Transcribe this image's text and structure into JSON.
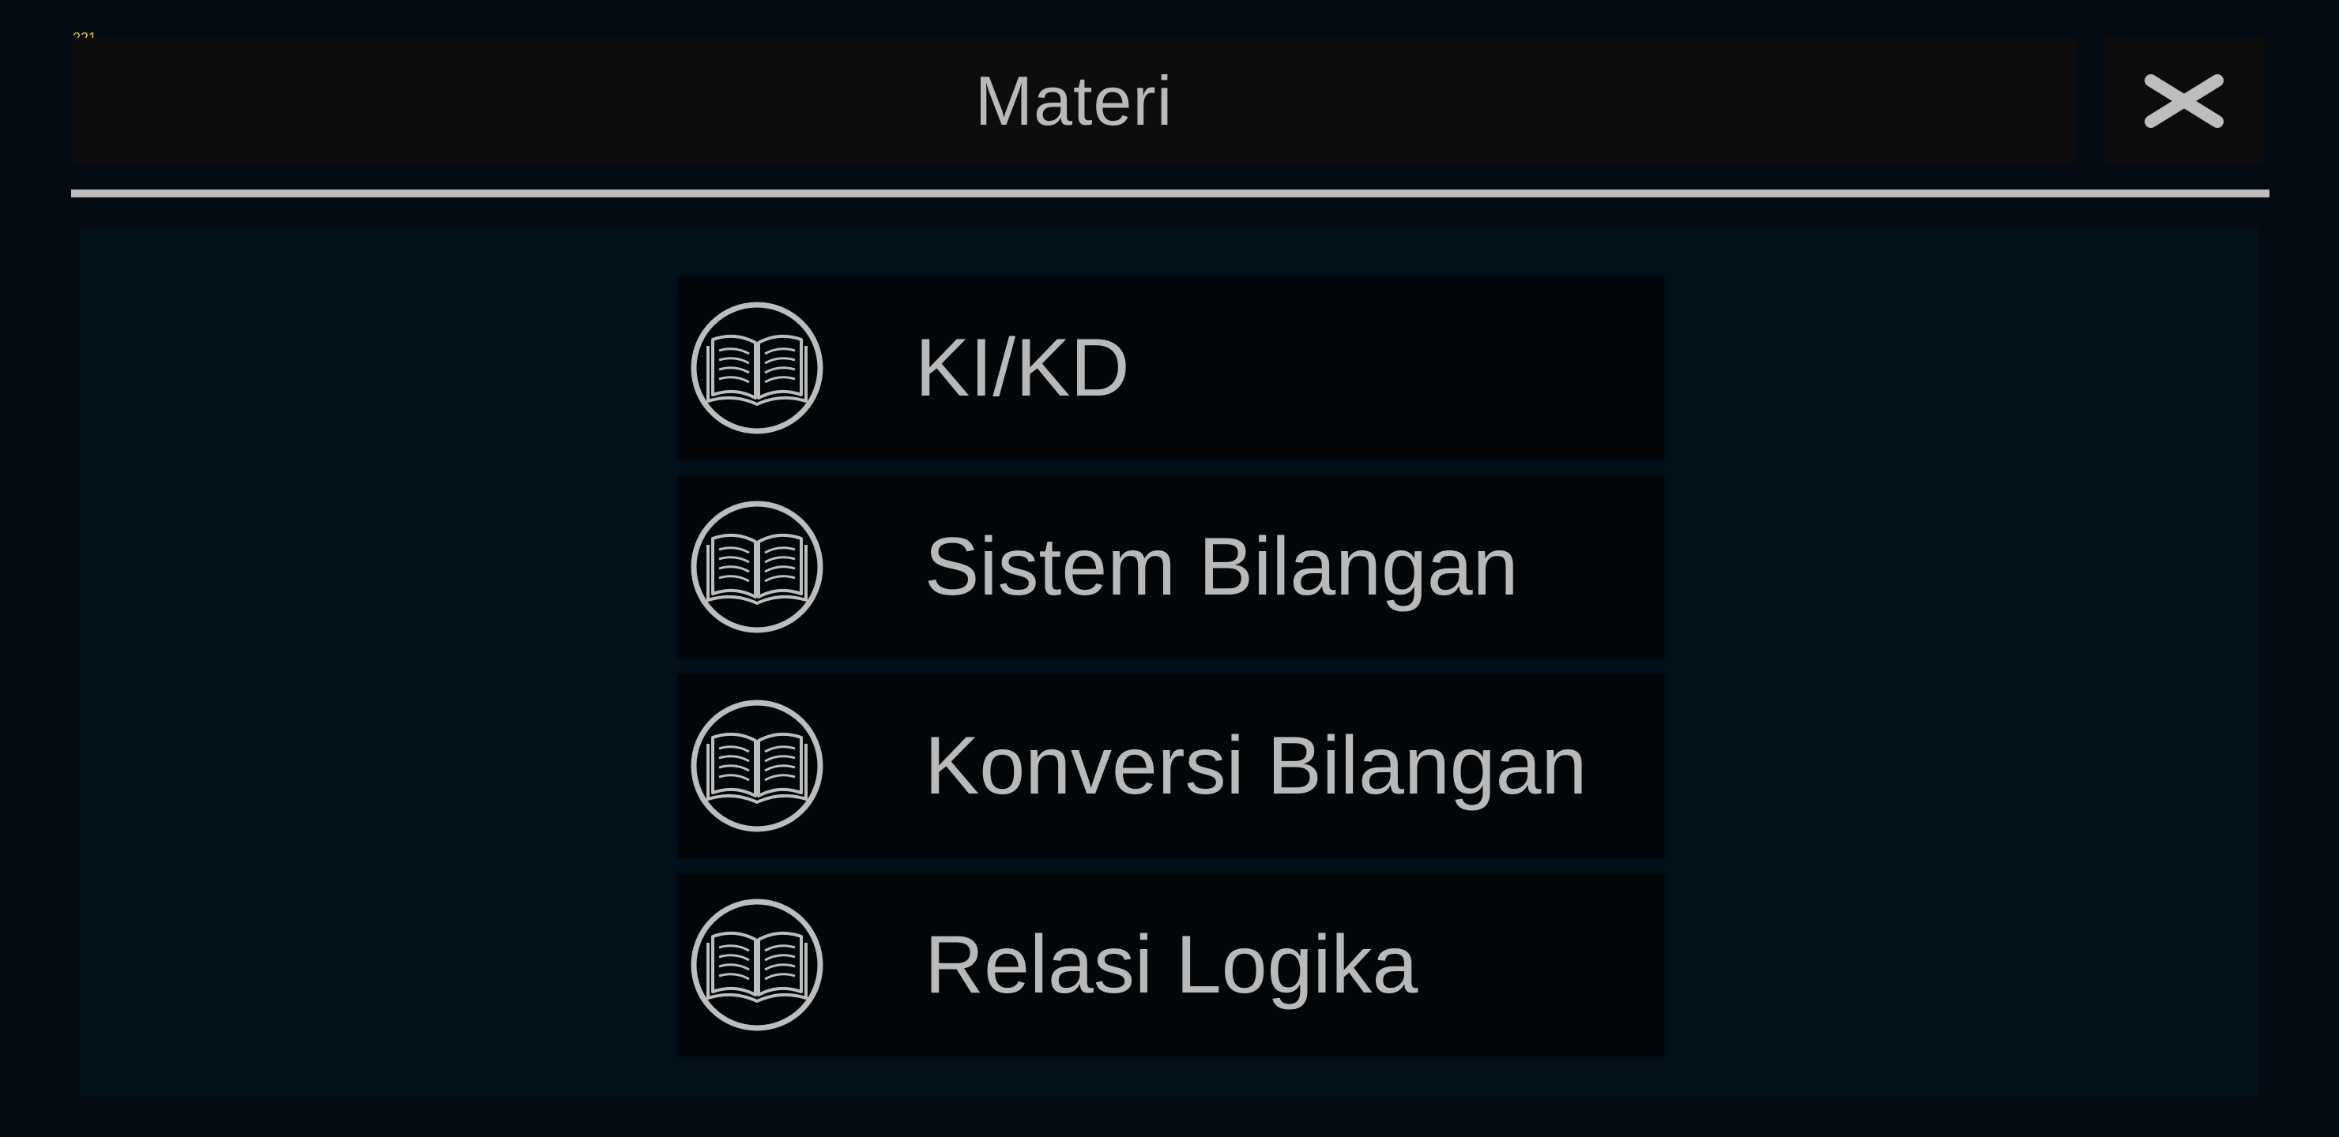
{
  "debug": {
    "fps_counter": "221"
  },
  "header": {
    "title": "Materi",
    "close_icon": "close-icon"
  },
  "menu": {
    "items": [
      {
        "label": "KI/KD",
        "icon": "book-icon"
      },
      {
        "label": "Sistem Bilangan",
        "icon": "book-icon"
      },
      {
        "label": "Konversi Bilangan",
        "icon": "book-icon"
      },
      {
        "label": "Relasi Logika",
        "icon": "book-icon"
      }
    ]
  },
  "colors": {
    "background": "#040b12",
    "panel": "#03111a",
    "button": "#020608",
    "text": "#b9b9b9",
    "fps_text": "#d6c21c"
  }
}
